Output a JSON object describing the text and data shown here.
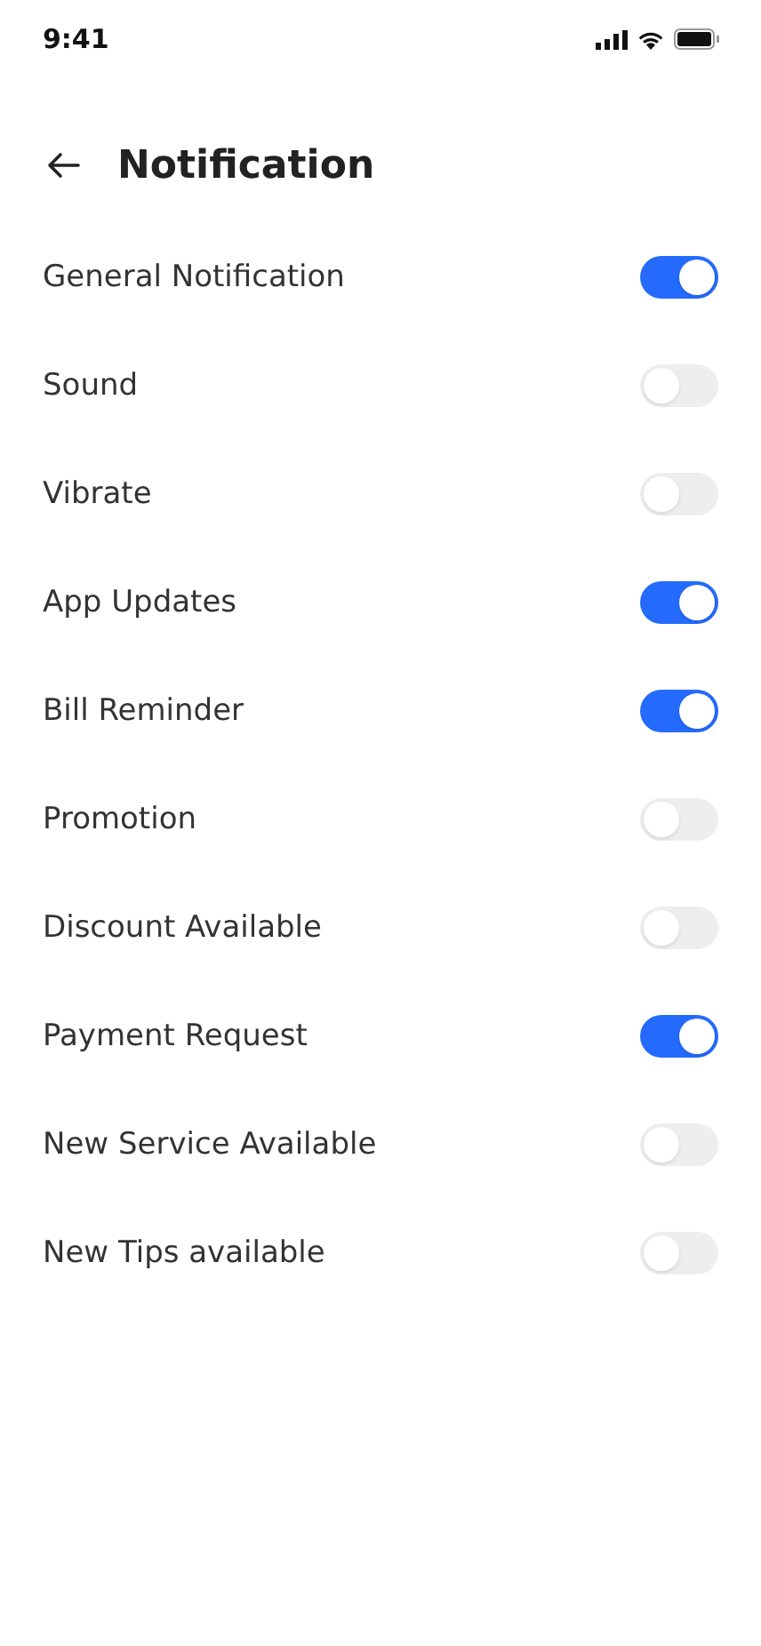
{
  "status_bar": {
    "time": "9:41"
  },
  "header": {
    "title": "Notification"
  },
  "settings": [
    {
      "label": "General Notification",
      "on": true
    },
    {
      "label": "Sound",
      "on": false
    },
    {
      "label": "Vibrate",
      "on": false
    },
    {
      "label": "App Updates",
      "on": true
    },
    {
      "label": "Bill Reminder",
      "on": true
    },
    {
      "label": "Promotion",
      "on": false
    },
    {
      "label": "Discount Available",
      "on": false
    },
    {
      "label": "Payment Request",
      "on": true
    },
    {
      "label": "New Service Available",
      "on": false
    },
    {
      "label": "New Tips available",
      "on": false
    }
  ]
}
